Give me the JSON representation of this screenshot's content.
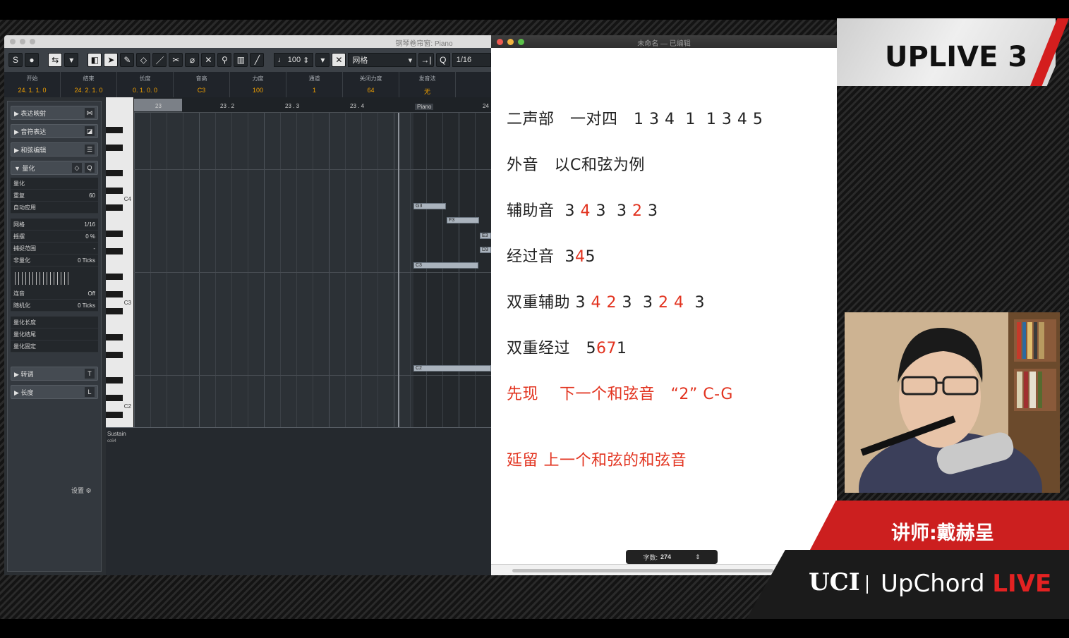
{
  "daw": {
    "window_title": "钢琴卷帘窗:  Piano",
    "toolbar": {
      "velocity": "100",
      "grid_label": "网格",
      "quantize_value": "1/16"
    },
    "info": [
      {
        "label": "开始",
        "value": "24. 1. 1.  0"
      },
      {
        "label": "结束",
        "value": "24. 2. 1.  0"
      },
      {
        "label": "长度",
        "value": "0. 1. 0.  0"
      },
      {
        "label": "音高",
        "value": "C3"
      },
      {
        "label": "力度",
        "value": "100"
      },
      {
        "label": "通道",
        "value": "1"
      },
      {
        "label": "关闭力度",
        "value": "64"
      },
      {
        "label": "发音法",
        "value": "无"
      }
    ],
    "inspector": {
      "sections": [
        "表达映射",
        "音符表达",
        "和弦编辑"
      ],
      "quantize_header": "量化",
      "rows_a": [
        {
          "label": "量化",
          "value": ""
        },
        {
          "label": "重复",
          "value": "60"
        },
        {
          "label": "自动应用",
          "value": ""
        }
      ],
      "rows_b": [
        {
          "label": "网格",
          "value": "1/16"
        },
        {
          "label": "摇摆",
          "value": "0 %"
        },
        {
          "label": "捕捉范围",
          "value": "-"
        },
        {
          "label": "非量化",
          "value": "0 Ticks"
        }
      ],
      "rows_c": [
        {
          "label": "连音",
          "value": "Off"
        },
        {
          "label": "随机化",
          "value": "0 Ticks"
        }
      ],
      "rows_d": [
        {
          "label": "量化长度",
          "value": ""
        },
        {
          "label": "量化结尾",
          "value": ""
        },
        {
          "label": "量化固定",
          "value": ""
        }
      ],
      "bottom_sections": [
        "转调",
        "长度"
      ],
      "settings_label": "设置"
    },
    "ruler": [
      "23",
      "23 . 2",
      "23 . 3",
      "23 . 4",
      "24"
    ],
    "key_labels": [
      "C4",
      "C3",
      "C2"
    ],
    "region_name": "Piano",
    "notes": [
      "G3",
      "F3",
      "E3",
      "D3",
      "C3",
      "C2"
    ],
    "controller_lane": "Sustain",
    "controller_sub": "cc64"
  },
  "doc": {
    "window_title": "未命名 — 已编辑",
    "word_count_label": "字数:",
    "word_count": "274"
  },
  "branding": {
    "uplive": "UPLIVE 3",
    "lecturer": "讲师:戴赫呈",
    "logo": "UCI",
    "name": "UpChord",
    "live": "LIVE"
  },
  "colors": {
    "accent_red": "#e2331f",
    "brand_red": "#cc1f1f",
    "value_orange": "#f0a000"
  }
}
